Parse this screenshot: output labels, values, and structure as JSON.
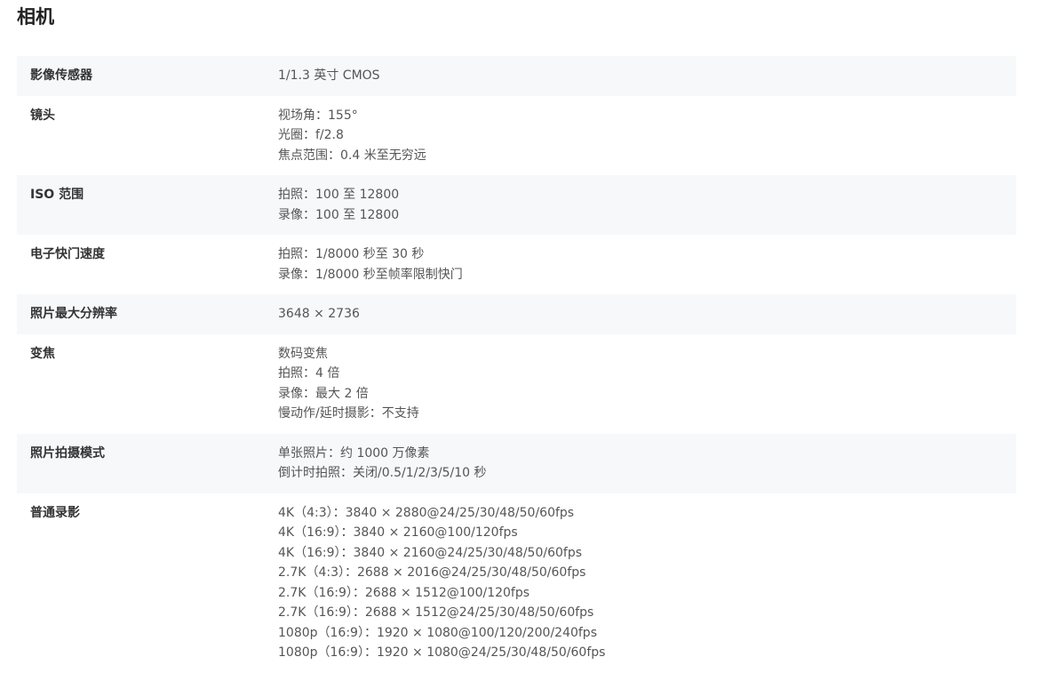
{
  "section": {
    "title": "相机"
  },
  "specs": [
    {
      "label": "影像传感器",
      "values": [
        "1/1.3 英寸 CMOS"
      ]
    },
    {
      "label": "镜头",
      "values": [
        "视场角：155°",
        "光圈：f/2.8",
        "焦点范围：0.4 米至无穷远"
      ]
    },
    {
      "label": "ISO 范围",
      "values": [
        "拍照：100 至 12800",
        "录像：100 至 12800"
      ]
    },
    {
      "label": "电子快门速度",
      "values": [
        "拍照：1/8000 秒至 30 秒",
        "录像：1/8000 秒至帧率限制快门"
      ]
    },
    {
      "label": "照片最大分辨率",
      "values": [
        "3648 × 2736"
      ]
    },
    {
      "label": "变焦",
      "values": [
        "数码变焦",
        "拍照：4 倍",
        "录像：最大 2 倍",
        "慢动作/延时摄影：不支持"
      ]
    },
    {
      "label": "照片拍摄模式",
      "values": [
        "单张照片：约 1000 万像素",
        "倒计时拍照：关闭/0.5/1/2/3/5/10 秒"
      ]
    },
    {
      "label": "普通录影",
      "values": [
        "4K（4:3）：3840 × 2880@24/25/30/48/50/60fps",
        "4K（16:9）：3840 × 2160@100/120fps",
        "4K（16:9）：3840 × 2160@24/25/30/48/50/60fps",
        "2.7K（4:3）：2688 × 2016@24/25/30/48/50/60fps",
        "2.7K（16:9）：2688 × 1512@100/120fps",
        "2.7K（16:9）：2688 × 1512@24/25/30/48/50/60fps",
        "1080p（16:9）：1920 × 1080@100/120/200/240fps",
        "1080p（16:9）：1920 × 1080@24/25/30/48/50/60fps"
      ]
    }
  ]
}
